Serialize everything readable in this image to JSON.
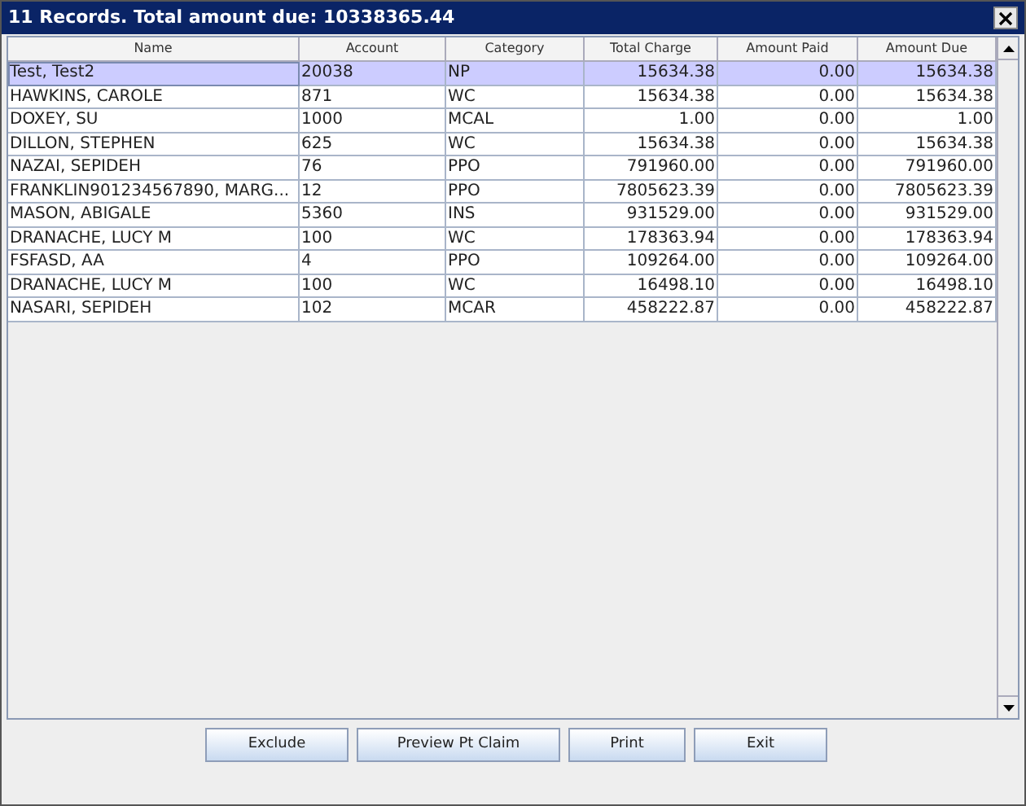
{
  "window": {
    "title": "11 Records. Total amount due: 10338365.44"
  },
  "table": {
    "columns": [
      "Name",
      "Account",
      "Category",
      "Total Charge",
      "Amount Paid",
      "Amount Due"
    ],
    "rows": [
      {
        "selected": true,
        "cells": [
          "Test, Test2",
          "20038",
          "NP",
          "15634.38",
          "0.00",
          "15634.38"
        ]
      },
      {
        "selected": false,
        "cells": [
          "HAWKINS, CAROLE",
          "871",
          "WC",
          "15634.38",
          "0.00",
          "15634.38"
        ]
      },
      {
        "selected": false,
        "cells": [
          "DOXEY, SU",
          "1000",
          "MCAL",
          "1.00",
          "0.00",
          "1.00"
        ]
      },
      {
        "selected": false,
        "cells": [
          "DILLON, STEPHEN",
          "625",
          "WC",
          "15634.38",
          "0.00",
          "15634.38"
        ]
      },
      {
        "selected": false,
        "cells": [
          "NAZAI, SEPIDEH",
          "76",
          "PPO",
          "791960.00",
          "0.00",
          "791960.00"
        ]
      },
      {
        "selected": false,
        "cells": [
          "FRANKLIN901234567890, MARG...",
          "12",
          "PPO",
          "7805623.39",
          "0.00",
          "7805623.39"
        ]
      },
      {
        "selected": false,
        "cells": [
          "MASON, ABIGALE",
          "5360",
          "INS",
          "931529.00",
          "0.00",
          "931529.00"
        ]
      },
      {
        "selected": false,
        "cells": [
          "DRANACHE, LUCY M",
          "100",
          "WC",
          "178363.94",
          "0.00",
          "178363.94"
        ]
      },
      {
        "selected": false,
        "cells": [
          "FSFASD, AA",
          "4",
          "PPO",
          "109264.00",
          "0.00",
          "109264.00"
        ]
      },
      {
        "selected": false,
        "cells": [
          "DRANACHE, LUCY M",
          "100",
          "WC",
          "16498.10",
          "0.00",
          "16498.10"
        ]
      },
      {
        "selected": false,
        "cells": [
          "NASARI, SEPIDEH",
          "102",
          "MCAR",
          "458222.87",
          "0.00",
          "458222.87"
        ]
      }
    ]
  },
  "buttons": [
    "Exclude",
    "Preview Pt Claim",
    "Print",
    "Exit"
  ]
}
